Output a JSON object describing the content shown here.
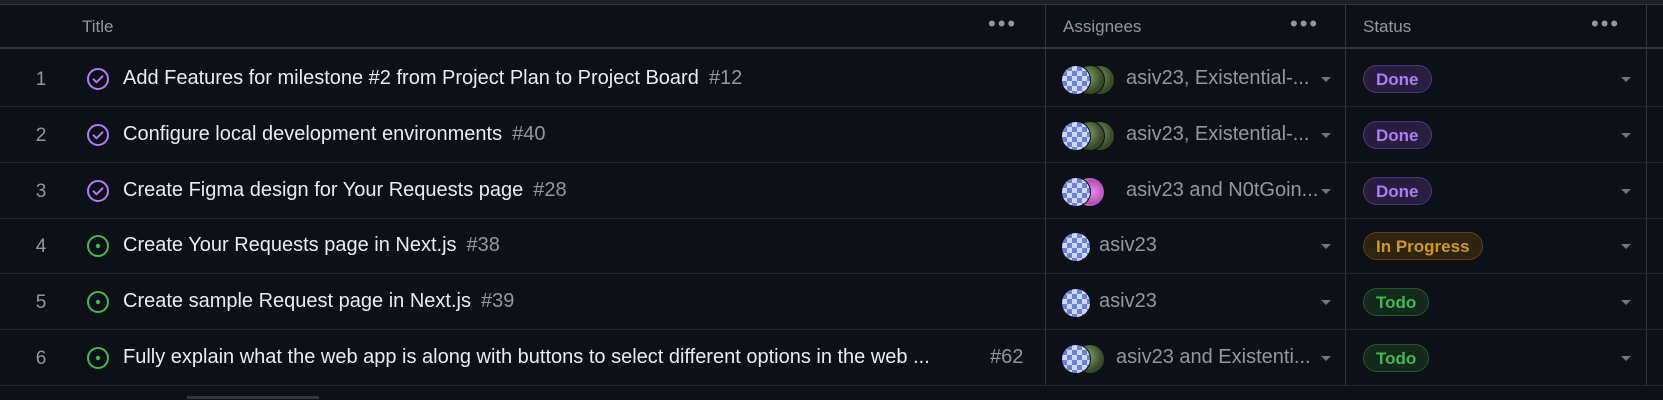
{
  "columns": {
    "title": "Title",
    "assignees": "Assignees",
    "status": "Status",
    "menu_glyph": "•••"
  },
  "colors": {
    "done": "#ab7df8",
    "in_progress": "#d29922",
    "todo": "#3fb950",
    "background": "#0d1117"
  },
  "rows": [
    {
      "index": "1",
      "state_icon": "closed-issue-icon",
      "title": "Add Features for milestone #2 from Project Plan to Project Board",
      "number": "#12",
      "assignees": "asiv23, Existential-...",
      "status": "Done"
    },
    {
      "index": "2",
      "state_icon": "closed-issue-icon",
      "title": "Configure local development environments",
      "number": "#40",
      "assignees": "asiv23, Existential-...",
      "status": "Done"
    },
    {
      "index": "3",
      "state_icon": "closed-issue-icon",
      "title": "Create Figma design for Your Requests page",
      "number": "#28",
      "assignees": "asiv23 and N0tGoin...",
      "status": "Done"
    },
    {
      "index": "4",
      "state_icon": "open-issue-icon",
      "title": "Create Your Requests page in Next.js",
      "number": "#38",
      "assignees": "asiv23",
      "status": "In Progress"
    },
    {
      "index": "5",
      "state_icon": "open-issue-icon",
      "title": "Create sample Request page in Next.js",
      "number": "#39",
      "assignees": "asiv23",
      "status": "Todo"
    },
    {
      "index": "6",
      "state_icon": "open-issue-icon",
      "title": "Fully explain what the web app is along with buttons to select different options in the web ...",
      "number": "#62",
      "assignees": "asiv23 and Existenti...",
      "status": "Todo"
    }
  ]
}
